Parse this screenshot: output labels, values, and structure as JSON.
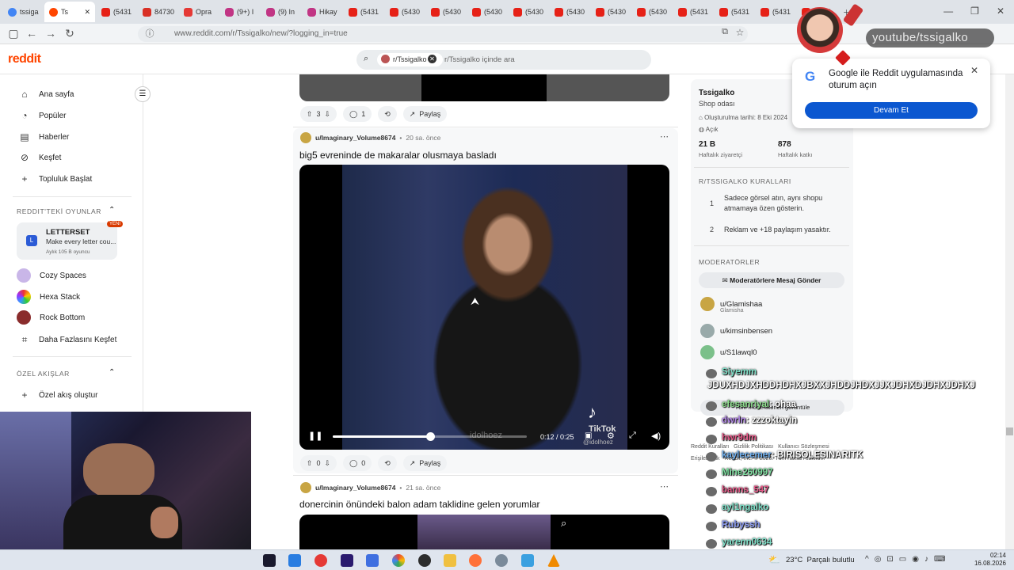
{
  "browser": {
    "tabs": [
      {
        "label": "tssiga",
        "fav": "g"
      },
      {
        "label": "Ts",
        "fav": "rd",
        "active": true
      },
      {
        "label": "(5431",
        "fav": "yt"
      },
      {
        "label": "84730",
        "fav": "gm"
      },
      {
        "label": "Opra",
        "fav": "opr"
      },
      {
        "label": "(9+) I",
        "fav": "ig"
      },
      {
        "label": "(9) In",
        "fav": "ig"
      },
      {
        "label": "Hikay",
        "fav": "ig"
      },
      {
        "label": "(5431",
        "fav": "yt"
      },
      {
        "label": "(5430",
        "fav": "yt"
      },
      {
        "label": "(5430",
        "fav": "yt"
      },
      {
        "label": "(5430",
        "fav": "yt"
      },
      {
        "label": "(5430",
        "fav": "yt"
      },
      {
        "label": "(5430",
        "fav": "yt"
      },
      {
        "label": "(5430",
        "fav": "yt"
      },
      {
        "label": "(5430",
        "fav": "yt"
      },
      {
        "label": "(5431",
        "fav": "yt"
      },
      {
        "label": "(5431",
        "fav": "yt"
      },
      {
        "label": "(5431",
        "fav": "yt"
      },
      {
        "label": "(5431",
        "fav": "yt"
      }
    ],
    "url": "www.reddit.com/r/Tssigalko/new/?logging_in=true"
  },
  "header": {
    "logo": "reddit",
    "search_chip": "r/Tssigalko",
    "search_placeholder": "r/Tssigalko içinde ara"
  },
  "sidebar": {
    "items": [
      "Ana sayfa",
      "Popüler",
      "Haberler",
      "Keşfet",
      "Topluluk Başlat"
    ],
    "games_header": "REDDIT'TEKİ OYUNLAR",
    "game_card": {
      "title": "LETTERSET",
      "subtitle": "Make every letter cou...",
      "meta": "Aylık 105 B oyuncu",
      "badge": "YENİ"
    },
    "games": [
      "Cozy Spaces",
      "Hexa Stack",
      "Rock Bottom",
      "Daha Fazlasını Keşfet"
    ],
    "feeds_header": "ÖZEL AKIŞLAR",
    "create_feed": "Özel akış oluştur"
  },
  "feed": {
    "top_post": {
      "votes": "3",
      "comments": "1",
      "share": "Paylaş"
    },
    "post1": {
      "author": "u/Imaginary_Volume8674",
      "time": "20 sa. önce",
      "title": "big5 evreninde de makaralar olusmaya basladı",
      "watermark": "TikTok",
      "watermark_handle": "@idolhoez",
      "overlay_handle": "idolhoez",
      "video_time": "0:12 / 0:25",
      "progress": 0.5,
      "votes": "0",
      "comments": "0",
      "share": "Paylaş"
    },
    "post2": {
      "author": "u/Imaginary_Volume8674",
      "time": "21 sa. önce",
      "title": "donercinin önündeki balon adam taklidine gelen yorumlar"
    }
  },
  "community": {
    "name": "Tssigalko",
    "desc": "Shop odası",
    "created": "Oluşturulma tarihi: 8 Eki 2024",
    "status": "Açık",
    "visitors_value": "21 B",
    "visitors_label": "Haftalık ziyaretçi",
    "contrib_value": "878",
    "contrib_label": "Haftalık katkı",
    "rules_header": "R/TSSIGALKO KURALLARI",
    "rules": [
      {
        "n": "1",
        "text": "Sadece görsel atın, aynı shopu atmamaya özen gösterin."
      },
      {
        "n": "2",
        "text": "Reklam ve +18 paylaşım yasaktır."
      }
    ],
    "mods_header": "MODERATÖRLER",
    "mods_button": "Moderatörlere Mesaj Gönder",
    "mods": [
      {
        "name": "u/Glamishaa",
        "sub": "Glamisha"
      },
      {
        "name": "u/kimsinbensen",
        "sub": ""
      },
      {
        "name": "u/S1lawql0",
        "sub": ""
      }
    ],
    "all_mods": "Tüm moderatörleri görüntüle",
    "footer1": "Reddit Kuralları   Gizlilik Politikası   Kullanıcı Sözleşmesi",
    "footer2": "Erişilebilirlik   Reddit, Inc. © 2026. Tüm hakları saklıdır."
  },
  "google_popup": {
    "title": "Google ile Reddit uygulamasında oturum açın",
    "button": "Devam Et"
  },
  "overlay": {
    "yt_badge": "youtube/tssigalko",
    "chat": [
      {
        "user": "Siyemm",
        "msg": "",
        "color": "#7ee0c8"
      },
      {
        "user": "",
        "msg": "JDUXHDJXHDDHDHXJBXXJHDDJHDXJJXJDHXDJDHXJDHXJ",
        "color": "#ffffff"
      },
      {
        "user": "efesanriyal",
        "msg": ": ohaa",
        "color": "#8fe08f"
      },
      {
        "user": "dwrln",
        "msg": ": zzzoktayin",
        "color": "#b48ae8"
      },
      {
        "user": "hwr9dm",
        "msg": "",
        "color": "#e85a8a"
      },
      {
        "user": "kaylecemer",
        "msg": ": BIRISOLESINARITK",
        "color": "#6fb0f0"
      },
      {
        "user": "Mine260997",
        "msg": "",
        "color": "#7ee0a0"
      },
      {
        "user": "banns_547",
        "msg": "",
        "color": "#e85a8a"
      },
      {
        "user": "ayl1ngalko",
        "msg": "",
        "color": "#7ee0c8"
      },
      {
        "user": "Rubyssh",
        "msg": "",
        "color": "#8a9af0"
      },
      {
        "user": "yarenn0634",
        "msg": "",
        "color": "#7ee0c8"
      }
    ]
  },
  "taskbar": {
    "weather": "23°C  Parçalı bulutlu",
    "time": "02:14",
    "date": "16.08.2026"
  },
  "colors": {
    "reddit_orange": "#ff4500",
    "google_blue": "#0b57d0"
  }
}
